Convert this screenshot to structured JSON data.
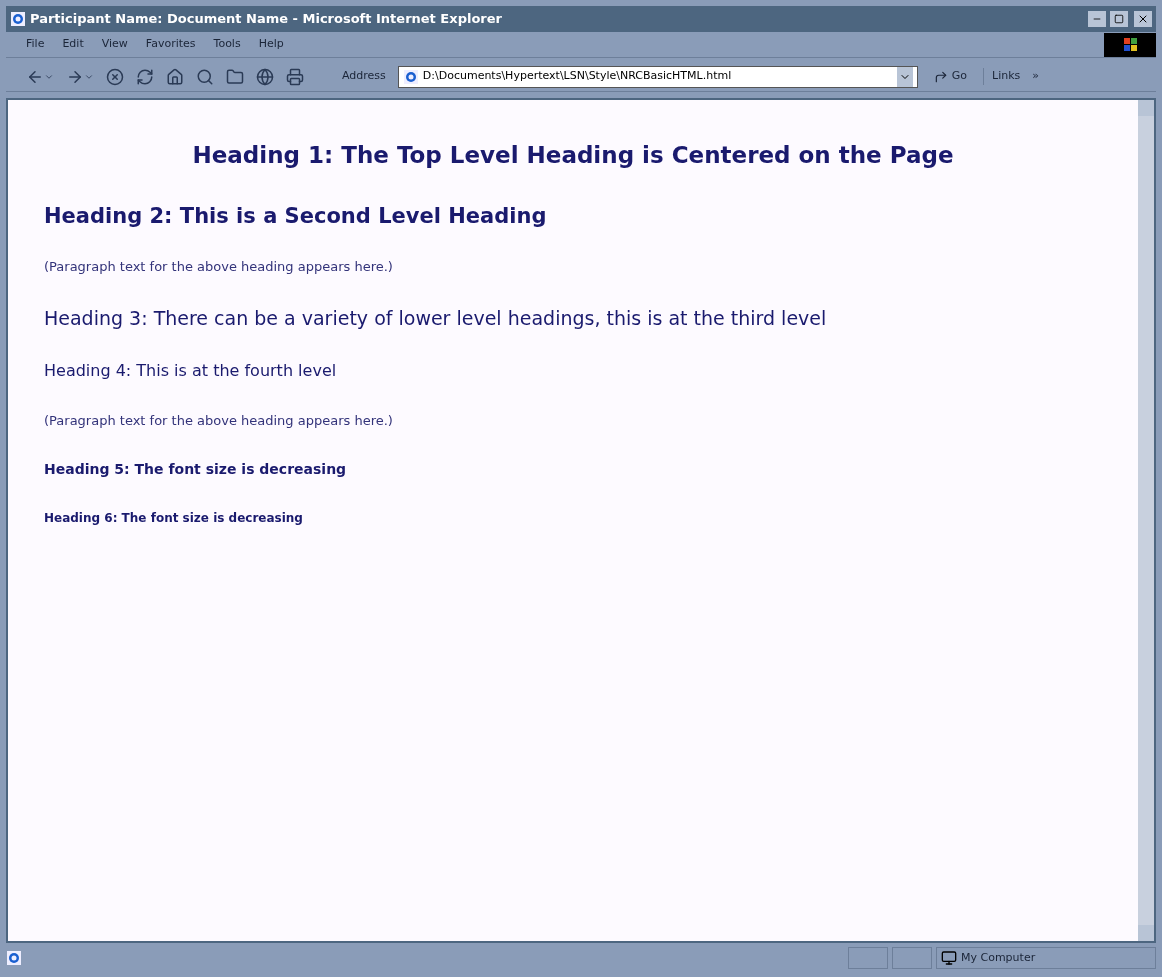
{
  "window": {
    "title": "Participant Name: Document Name - Microsoft Internet Explorer"
  },
  "menu": [
    "File",
    "Edit",
    "View",
    "Favorites",
    "Tools",
    "Help"
  ],
  "address_bar": {
    "label": "Address",
    "value": "D:\\Documents\\Hypertext\\LSN\\Style\\NRCBasicHTML.html",
    "go": "Go",
    "links": "Links",
    "more": "»"
  },
  "content": [
    {
      "kind": "h1",
      "text": "Heading 1: The Top Level Heading is Centered on the Page"
    },
    {
      "kind": "h2",
      "text": "Heading 2: This is a Second Level Heading"
    },
    {
      "kind": "p",
      "text": "(Paragraph text for the above heading appears here.)"
    },
    {
      "kind": "h3",
      "text": "Heading 3: There can be a variety of lower level headings, this is at the third level"
    },
    {
      "kind": "h4",
      "text": "Heading 4: This is at the fourth level"
    },
    {
      "kind": "p",
      "text": "(Paragraph text for the above heading appears here.)"
    },
    {
      "kind": "h5",
      "text": "Heading 5: The font size is decreasing"
    },
    {
      "kind": "h6",
      "text": "Heading 6: The font size is decreasing"
    }
  ],
  "status_bar": {
    "zone": "My Computer"
  }
}
